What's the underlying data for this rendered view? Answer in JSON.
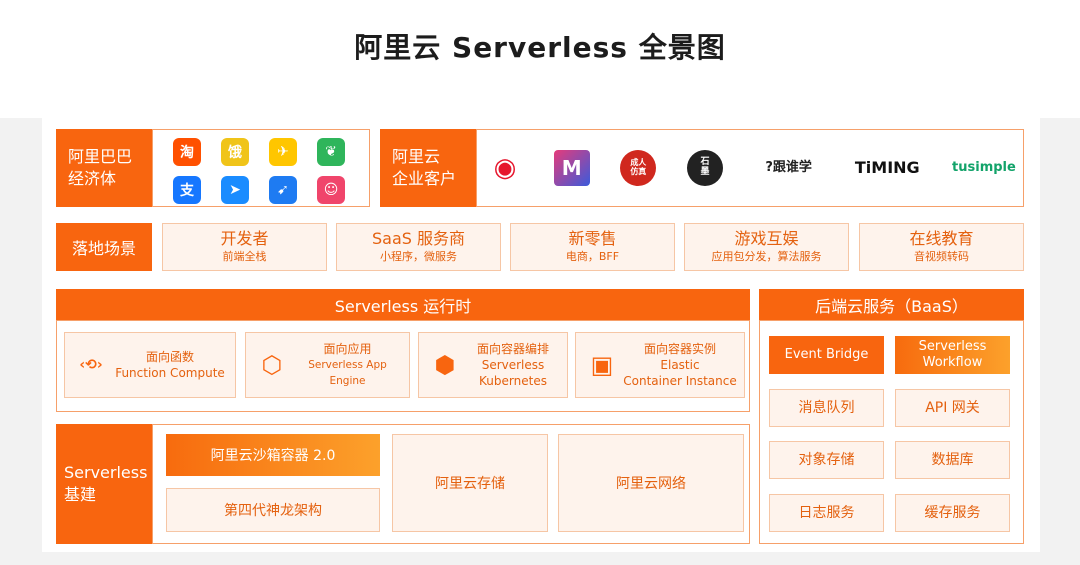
{
  "title": "阿里云 Serverless 全景图",
  "alibaba": {
    "label_line1": "阿里巴巴",
    "label_line2": "经济体",
    "apps": [
      {
        "icon": "taobao-icon",
        "glyph": "淘",
        "color": "#ff5000"
      },
      {
        "icon": "eleme-icon",
        "glyph": "饿",
        "color": "#f0c419"
      },
      {
        "icon": "fliggy-icon",
        "glyph": "✈",
        "color": "#ffc600"
      },
      {
        "icon": "leaf-app-icon",
        "glyph": "❦",
        "color": "#2fb55b"
      },
      {
        "icon": "alipay-icon",
        "glyph": "支",
        "color": "#1677ff"
      },
      {
        "icon": "dingtalk-icon",
        "glyph": "➤",
        "color": "#1a8cff"
      },
      {
        "icon": "send-app-icon",
        "glyph": "➹",
        "color": "#1e7bf2"
      },
      {
        "icon": "pink-app-icon",
        "glyph": "☺",
        "color": "#f0456b"
      }
    ]
  },
  "enterprise": {
    "label_line1": "阿里云",
    "label_line2": "企业客户",
    "logos": [
      {
        "icon": "weibo-logo",
        "text": "◉"
      },
      {
        "icon": "m-cube-logo",
        "text": "M"
      },
      {
        "icon": "chengren-logo",
        "text": "成人\n仿真"
      },
      {
        "icon": "shimo-logo",
        "text": "石\n墨"
      },
      {
        "icon": "genshuixue-logo",
        "text": "?跟谁学"
      },
      {
        "icon": "timing-logo",
        "text": "TiMING"
      },
      {
        "icon": "tusimple-logo",
        "text": "tusimple"
      }
    ]
  },
  "scenarios": {
    "label": "落地场景",
    "items": [
      {
        "title": "开发者",
        "sub": "前端全栈"
      },
      {
        "title": "SaaS 服务商",
        "sub": "小程序，微服务"
      },
      {
        "title": "新零售",
        "sub": "电商，BFF"
      },
      {
        "title": "游戏互娱",
        "sub": "应用包分发，算法服务"
      },
      {
        "title": "在线教育",
        "sub": "音视频转码"
      }
    ]
  },
  "runtime": {
    "header": "Serverless 运行时",
    "cards": [
      {
        "icon": "function-compute-icon",
        "line1": "面向函数",
        "line2": "Function Compute",
        "line3": ""
      },
      {
        "icon": "app-engine-icon",
        "line1": "面向应用",
        "line2": "Serverless App Engine",
        "line3": ""
      },
      {
        "icon": "kubernetes-icon",
        "line1": "面向容器编排",
        "line2": "Serverless",
        "line3": "Kubernetes"
      },
      {
        "icon": "container-instance-icon",
        "line1": "面向容器实例",
        "line2": "Elastic",
        "line3": "Container Instance"
      }
    ]
  },
  "baas": {
    "header": "后端云服务（BaaS）",
    "items": [
      [
        "Event Bridge",
        "Serverless Workflow"
      ],
      [
        "消息队列",
        "API 网关"
      ],
      [
        "对象存储",
        "数据库"
      ],
      [
        "日志服务",
        "缓存服务"
      ]
    ]
  },
  "infra": {
    "label_line1": "Serverless",
    "label_line2": "基建",
    "sandbox": "阿里云沙箱容器 2.0",
    "shenlong": "第四代神龙架构",
    "storage": "阿里云存储",
    "network": "阿里云网络"
  }
}
